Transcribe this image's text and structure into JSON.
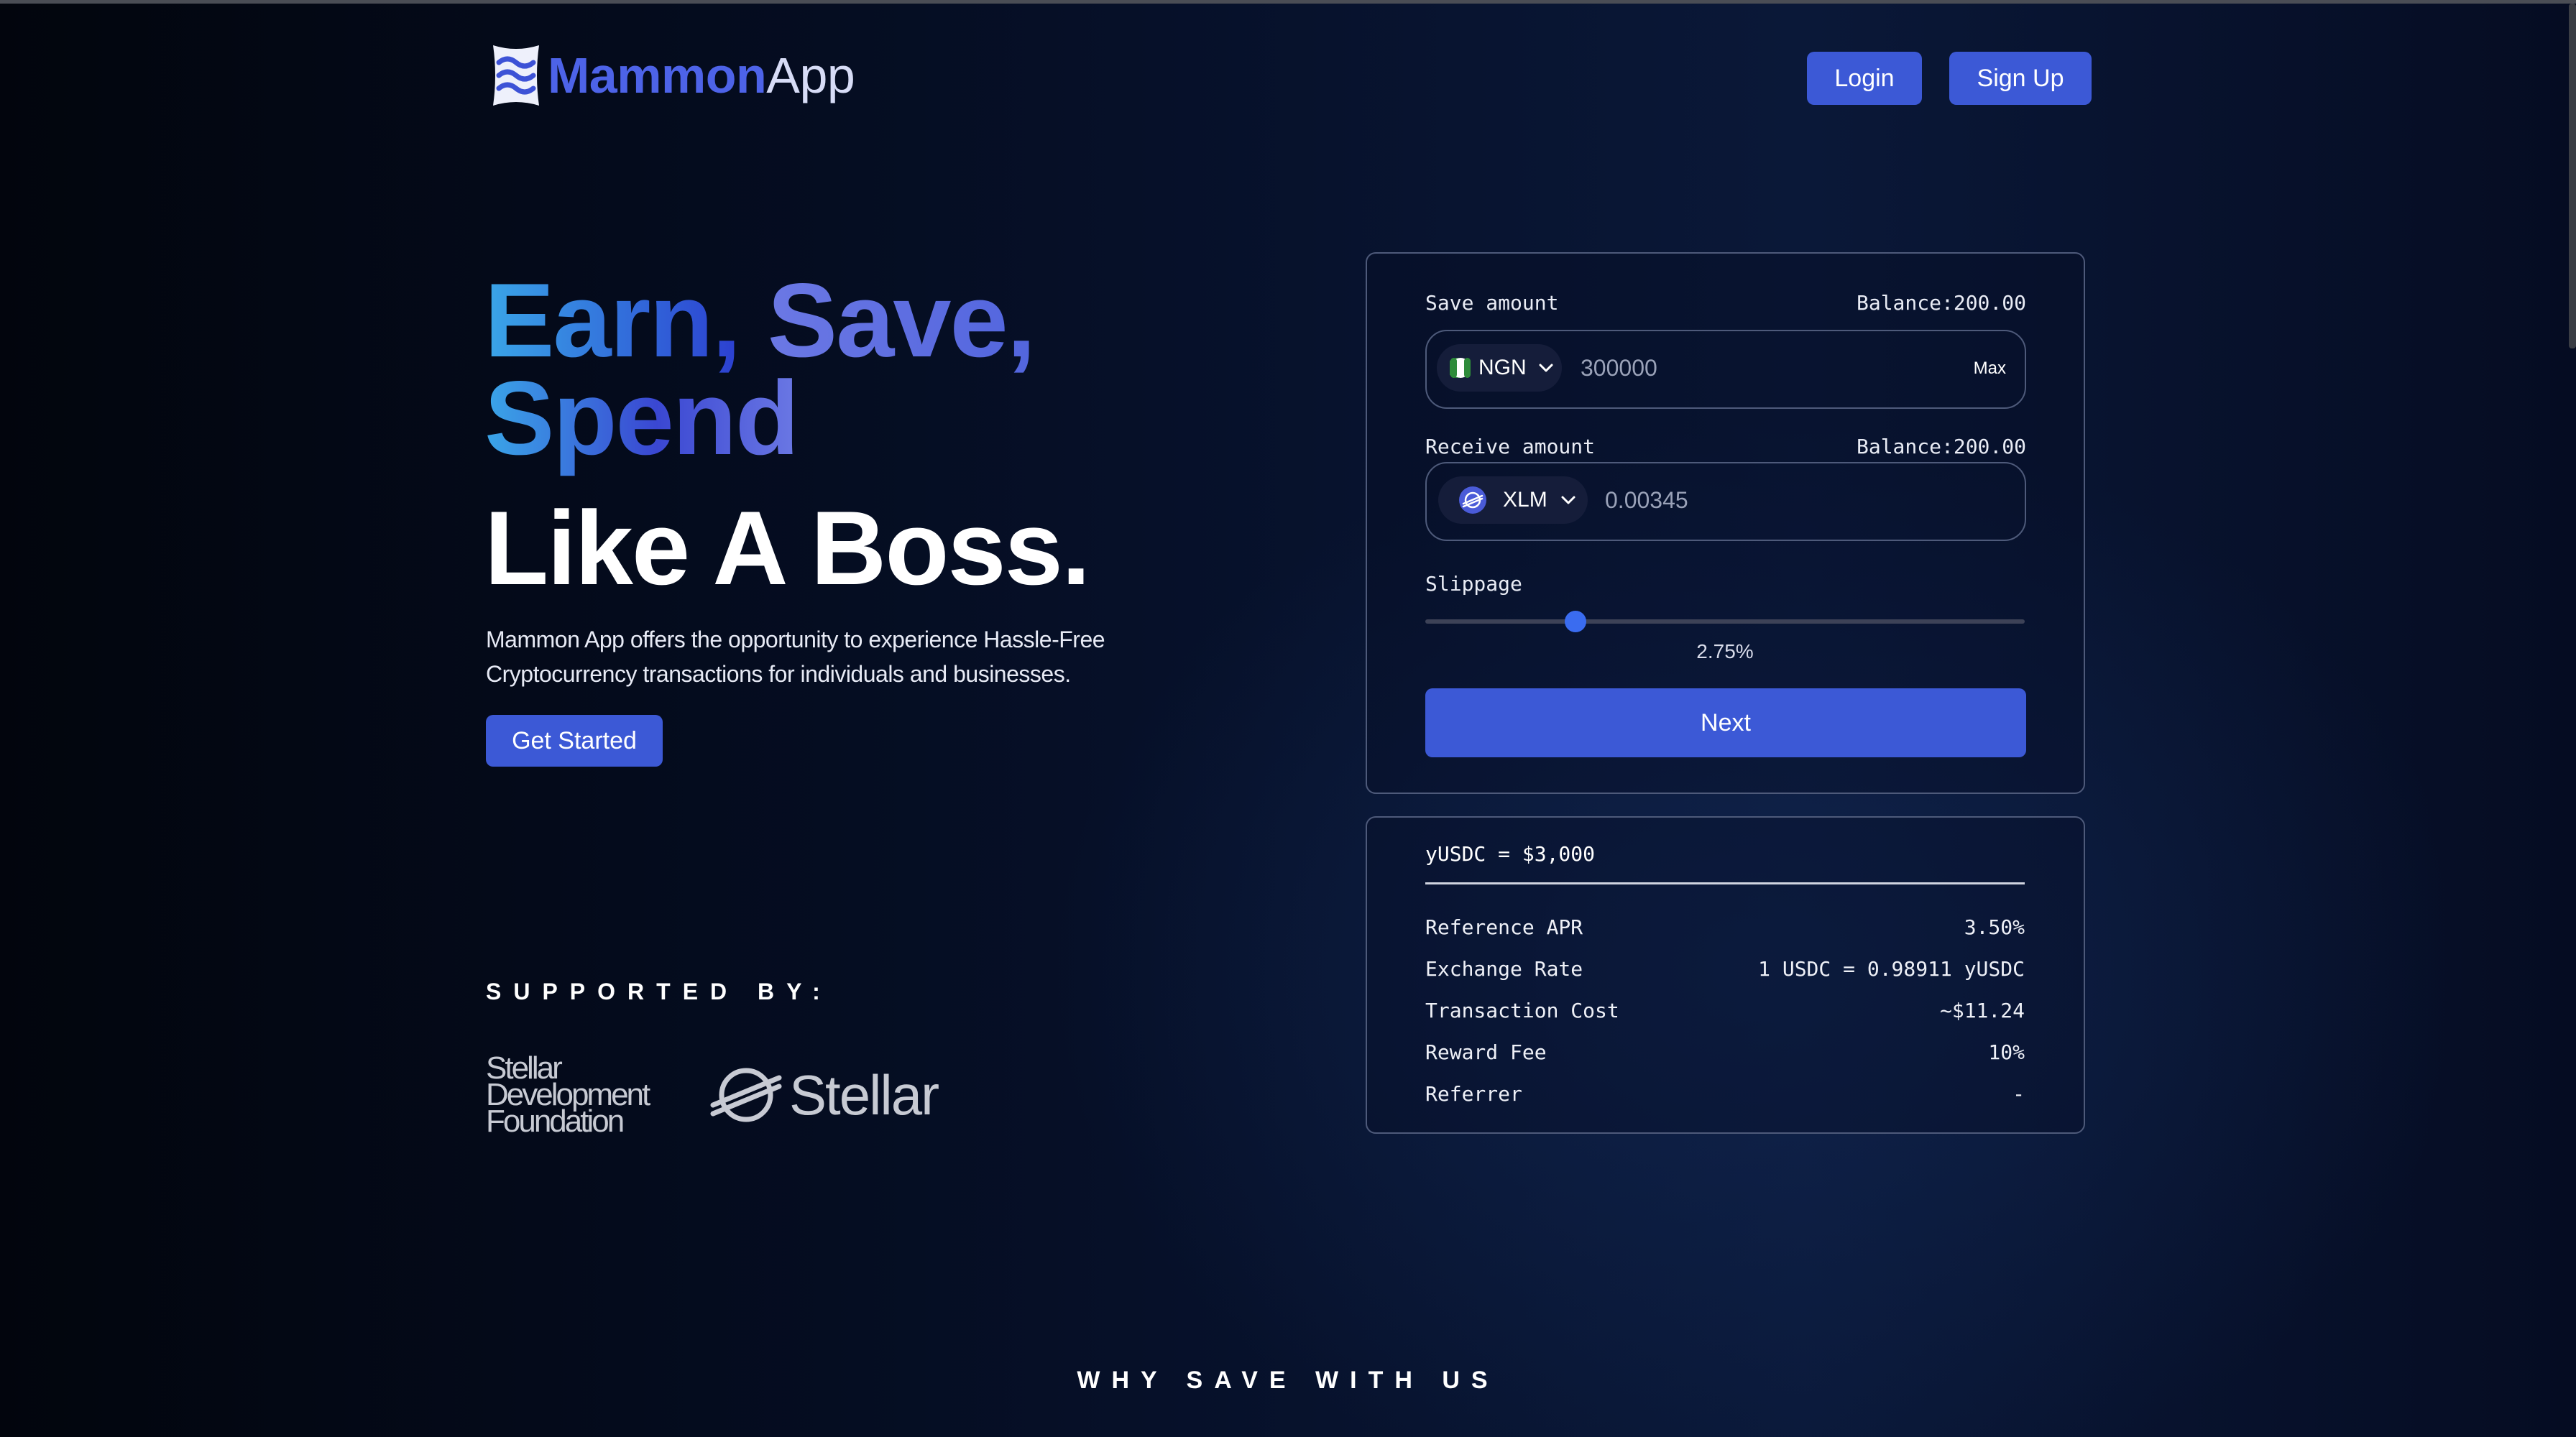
{
  "header": {
    "brand": "Mammon",
    "brand_suffix": "App",
    "login_label": "Login",
    "signup_label": "Sign Up"
  },
  "hero": {
    "line1_word1": "Earn,",
    "line1_word2": "Save,",
    "line1_word3": "Spend",
    "line2": "Like A Boss.",
    "description_line1": "Mammon App offers the opportunity to experience Hassle-Free",
    "description_line2": "Cryptocurrency transactions for individuals and businesses.",
    "cta_label": "Get Started"
  },
  "supported": {
    "heading": "SUPPORTED BY:",
    "sdf_line1": "Stellar",
    "sdf_line2": "Development",
    "sdf_line3": "Foundation",
    "stellar_wordmark": "Stellar"
  },
  "swap": {
    "save_label": "Save amount",
    "save_balance": "Balance:200.00",
    "save_currency": "NGN",
    "save_value": "300000",
    "max_label": "Max",
    "receive_label": "Receive amount",
    "receive_balance": "Balance:200.00",
    "receive_currency": "XLM",
    "receive_value": "0.00345",
    "slippage_label": "Slippage",
    "slippage_value": "2.75%",
    "slippage_fraction": 0.25,
    "next_label": "Next"
  },
  "info": {
    "title": "yUSDC = $3,000",
    "rows": [
      {
        "label": "Reference APR",
        "value": "3.50%"
      },
      {
        "label": "Exchange Rate",
        "value": "1 USDC = 0.98911 yUSDC"
      },
      {
        "label": "Transaction Cost",
        "value": "~$11.24"
      },
      {
        "label": "Reward Fee",
        "value": "10%"
      },
      {
        "label": "Referrer",
        "value": "-"
      }
    ]
  },
  "footer": {
    "why_heading": "WHY SAVE WITH US"
  },
  "colors": {
    "accent": "#3c59d6",
    "background": "#050b1d",
    "ngn_flag_green": "#2e8b3a",
    "xlm_icon": "#4a5bd8"
  },
  "icons": {
    "logo": "wave-logo-icon",
    "dropdown": "chevron-down-icon",
    "ngn": "ngn-flag-icon",
    "xlm": "stellar-xlm-icon"
  }
}
